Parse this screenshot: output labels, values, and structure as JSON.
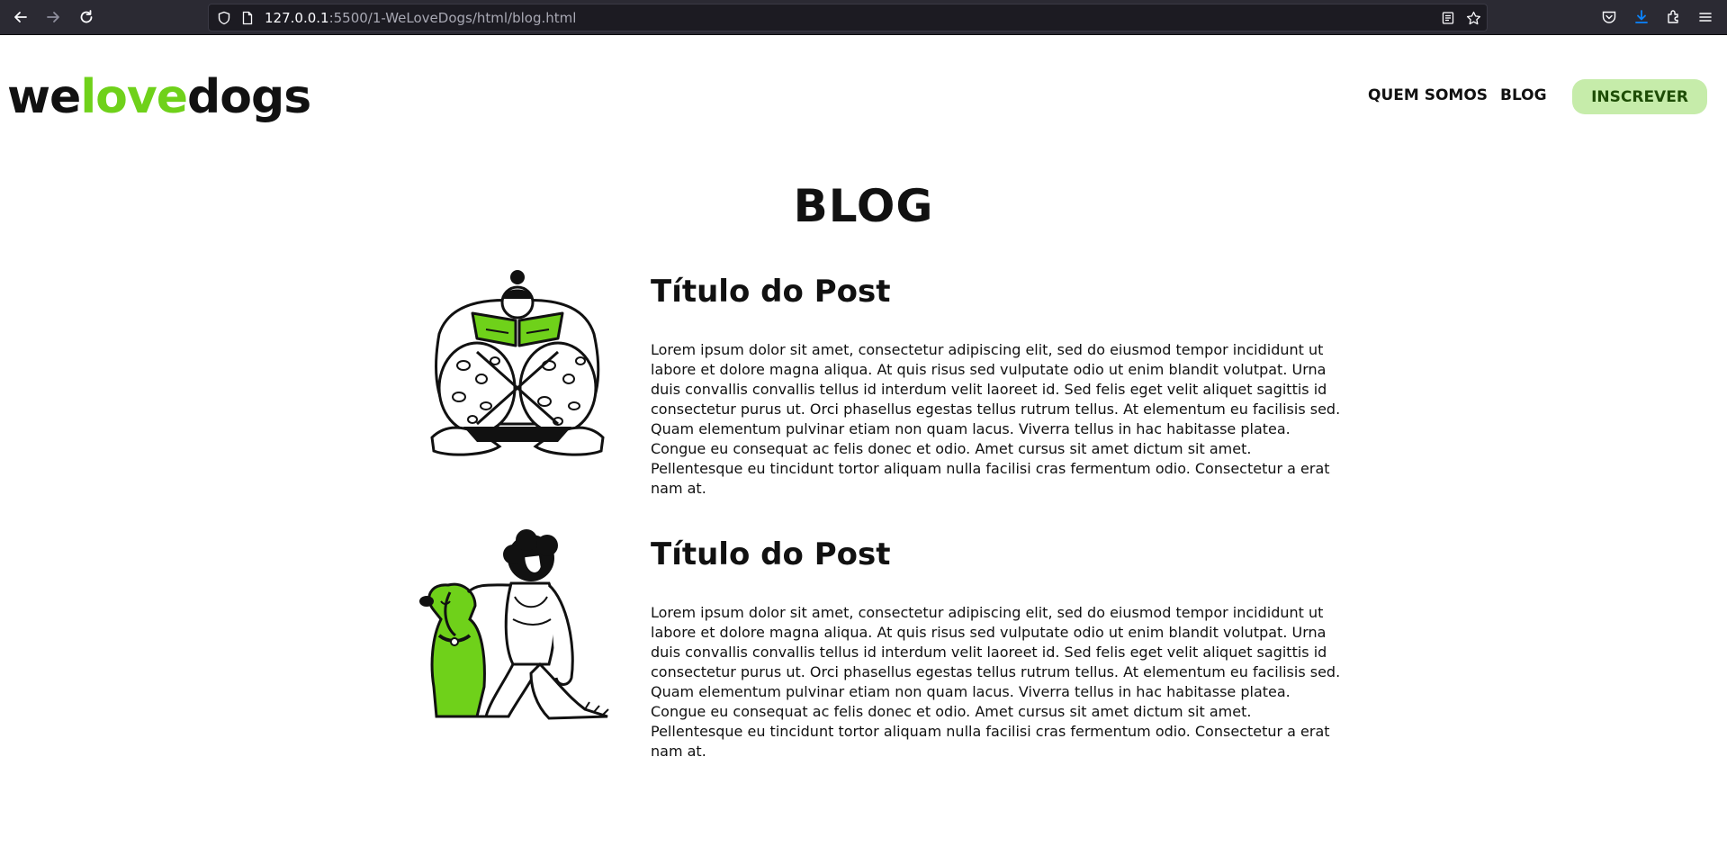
{
  "browser": {
    "url_host": "127.0.0.1",
    "url_rest": ":5500/1-WeLoveDogs/html/blog.html"
  },
  "header": {
    "logo_part1": "we",
    "logo_part2": "love",
    "logo_part3": "dogs",
    "nav": [
      {
        "label": "QUEM SOMOS"
      },
      {
        "label": "BLOG"
      }
    ],
    "subscribe_label": "INSCREVER"
  },
  "page": {
    "title": "BLOG"
  },
  "posts": [
    {
      "title": "Título do Post",
      "body": "Lorem ipsum dolor sit amet, consectetur adipiscing elit, sed do eiusmod tempor incididunt ut labore et dolore magna aliqua. At quis risus sed vulputate odio ut enim blandit volutpat. Urna duis convallis convallis tellus id interdum velit laoreet id. Sed felis eget velit aliquet sagittis id consectetur purus ut. Orci phasellus egestas tellus rutrum tellus. At elementum eu facilisis sed. Quam elementum pulvinar etiam non quam lacus. Viverra tellus in hac habitasse platea. Congue eu consequat ac felis donec et odio. Amet cursus sit amet dictum sit amet. Pellentesque eu tincidunt tortor aliquam nulla facilisi cras fermentum odio. Consectetur a erat nam at."
    },
    {
      "title": "Título do Post",
      "body": "Lorem ipsum dolor sit amet, consectetur adipiscing elit, sed do eiusmod tempor incididunt ut labore et dolore magna aliqua. At quis risus sed vulputate odio ut enim blandit volutpat. Urna duis convallis convallis tellus id interdum velit laoreet id. Sed felis eget velit aliquet sagittis id consectetur purus ut. Orci phasellus egestas tellus rutrum tellus. At elementum eu facilisis sed. Quam elementum pulvinar etiam non quam lacus. Viverra tellus in hac habitasse platea. Congue eu consequat ac felis donec et odio. Amet cursus sit amet dictum sit amet. Pellentesque eu tincidunt tortor aliquam nulla facilisi cras fermentum odio. Consectetur a erat nam at."
    }
  ],
  "colors": {
    "brand_green": "#6fd11a",
    "button_bg": "#c6ecaa",
    "chrome_bg": "#2b2a33"
  },
  "icons": [
    "back-arrow-icon",
    "forward-arrow-icon",
    "reload-icon",
    "shield-icon",
    "page-icon",
    "reader-view-icon",
    "bookmark-star-icon",
    "pocket-icon",
    "download-icon",
    "extensions-icon",
    "menu-icon"
  ]
}
